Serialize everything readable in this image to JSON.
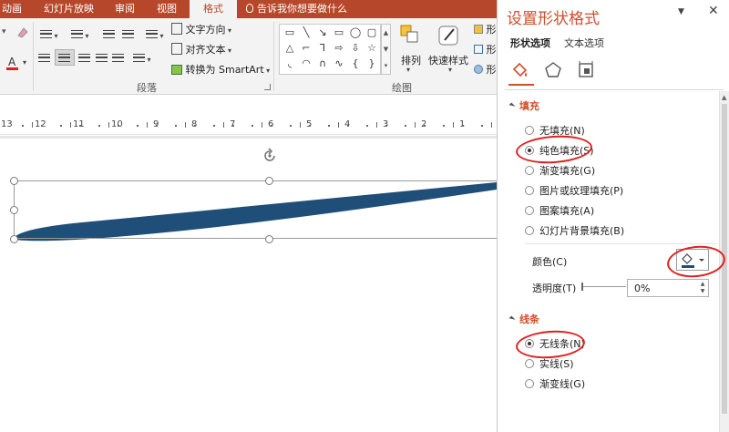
{
  "tabs": [
    {
      "label": "动画",
      "active": false
    },
    {
      "label": "幻灯片放映",
      "active": false
    },
    {
      "label": "审阅",
      "active": false
    },
    {
      "label": "视图",
      "active": false
    },
    {
      "label": "格式",
      "active": true
    }
  ],
  "tell_me": "告诉我你想要做什么",
  "ribbon": {
    "paragraph": {
      "label": "段落",
      "text_direction": "文字方向",
      "align_text": "对齐文本",
      "convert_smartart": "转换为 SmartArt"
    },
    "drawing": {
      "label": "绘图",
      "arrange": "排列",
      "quick_styles": "快速样式",
      "shape_fill_partial": "形",
      "shape_outline_partial": "形",
      "shape_effects_partial": "形"
    }
  },
  "ruler": {
    "numbers": [
      "13",
      "12",
      "11",
      "10",
      "9",
      "8",
      "7",
      "6",
      "5",
      "4",
      "3",
      "2",
      "1"
    ]
  },
  "pane": {
    "title": "设置形状格式",
    "tabs": [
      "形状选项",
      "文本选项"
    ],
    "fill": {
      "heading": "填充",
      "options": [
        {
          "label": "无填充(N)",
          "checked": false
        },
        {
          "label": "纯色填充(S)",
          "checked": true
        },
        {
          "label": "渐变填充(G)",
          "checked": false
        },
        {
          "label": "图片或纹理填充(P)",
          "checked": false
        },
        {
          "label": "图案填充(A)",
          "checked": false
        },
        {
          "label": "幻灯片背景填充(B)",
          "checked": false
        }
      ],
      "color_label": "颜色(C)",
      "transparency_label": "透明度(T)",
      "transparency_value": "0%"
    },
    "line": {
      "heading": "线条",
      "options": [
        {
          "label": "无线条(N)",
          "checked": true
        },
        {
          "label": "实线(S)",
          "checked": false
        },
        {
          "label": "渐变线(G)",
          "checked": false
        }
      ]
    }
  },
  "colors": {
    "accent": "#b7472a",
    "pane_accent": "#cf4f2c",
    "shape_fill": "#1f4e79",
    "annotation": "#e02020"
  },
  "icons": [
    "fill-line-icon",
    "effects-icon",
    "size-properties-icon",
    "paint-bucket-icon",
    "rotate-icon",
    "lightbulb-icon"
  ]
}
